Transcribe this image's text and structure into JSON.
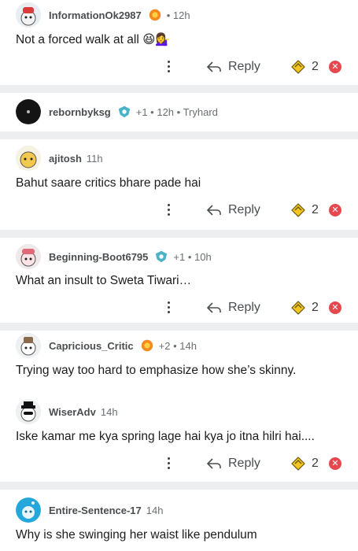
{
  "comments": [
    {
      "username": "InformationOk2987",
      "meta": "• 12h",
      "body": "Not a forced walk at all 😆💁‍♀️",
      "reply_label": "Reply",
      "award_count": "2"
    },
    {
      "username": "rebornbyksg",
      "meta": "+1 • 12h • Tryhard"
    },
    {
      "username": "ajitosh",
      "meta": "11h",
      "body": "Bahut saare critics bhare pade hai",
      "reply_label": "Reply",
      "award_count": "2"
    },
    {
      "username": "Beginning-Boot6795",
      "meta": "+1 • 10h",
      "body": "What an insult to Sweta Tiwari…",
      "reply_label": "Reply",
      "award_count": "2"
    },
    {
      "username": "Capricious_Critic",
      "meta": "+2 • 14h",
      "body": "Trying way too hard to emphasize how she’s skinny."
    },
    {
      "username": "WiserAdv",
      "meta": "14h",
      "body": "Iske kamar me kya spring lage hai kya jo itna hilri hai....",
      "reply_label": "Reply",
      "award_count": "2"
    },
    {
      "username": "Entire-Sentence-17",
      "meta": "14h",
      "body": "Why is she swinging her waist like pendulum"
    }
  ],
  "icons": {
    "more": "more-options-icon",
    "reply": "reply-arrow-icon",
    "award": "award-icon",
    "dismiss": "close-icon"
  },
  "colors": {
    "separator": "#eceef0",
    "dismiss": "#e5484d",
    "award": "#f3c623"
  }
}
